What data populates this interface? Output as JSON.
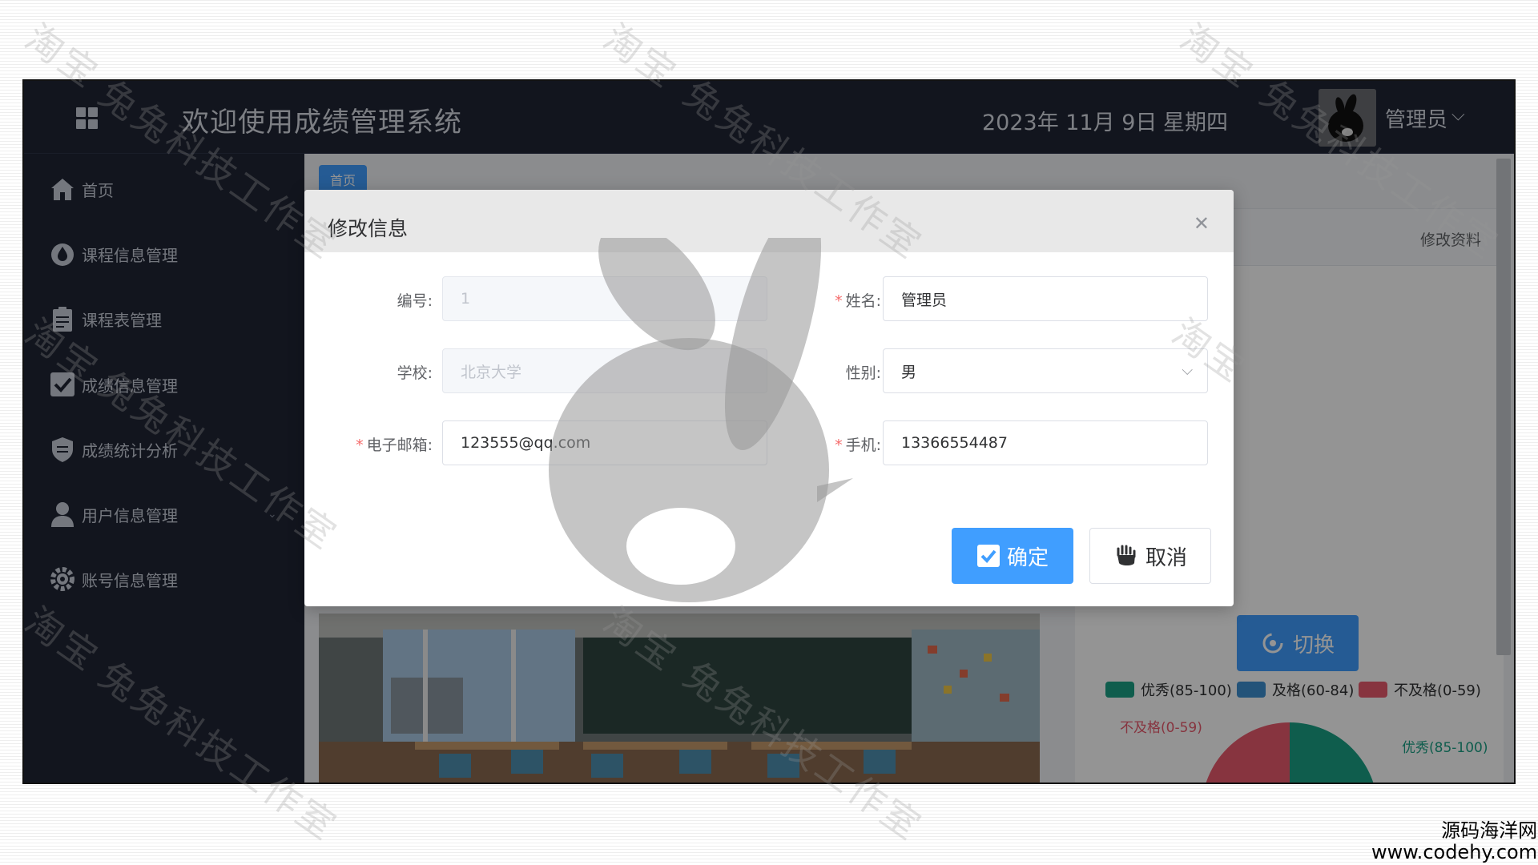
{
  "header": {
    "title": "欢迎使用成绩管理系统",
    "date": "2023年 11月 9日",
    "weekday": "星期四",
    "user_name": "管理员"
  },
  "sidebar": {
    "items": [
      {
        "label": "首页",
        "icon": "home-icon"
      },
      {
        "label": "课程信息管理",
        "icon": "drop-icon"
      },
      {
        "label": "课程表管理",
        "icon": "clipboard-icon"
      },
      {
        "label": "成绩信息管理",
        "icon": "checkbox-icon"
      },
      {
        "label": "成绩统计分析",
        "icon": "shield-icon"
      },
      {
        "label": "用户信息管理",
        "icon": "user-icon",
        "expandable": true
      },
      {
        "label": "账号信息管理",
        "icon": "gear-icon"
      }
    ]
  },
  "main": {
    "tab_home": "首页",
    "edit_profile": "修改资料",
    "switch_label": "切换",
    "legend": [
      {
        "label": "优秀(85-100)",
        "color": "#1aa085"
      },
      {
        "label": "及格(60-84)",
        "color": "#3d8fd0"
      },
      {
        "label": "不及格(0-59)",
        "color": "#e85a6d"
      }
    ],
    "pie_labels": {
      "left": "不及格(0-59)",
      "right": "优秀(85-100)"
    }
  },
  "dialog": {
    "title": "修改信息",
    "fields": {
      "id": {
        "label": "编号:",
        "value": "1",
        "required": false,
        "disabled": true
      },
      "name": {
        "label": "姓名:",
        "value": "管理员",
        "required": true
      },
      "school": {
        "label": "学校:",
        "value": "北京大学",
        "required": false,
        "disabled": true
      },
      "gender": {
        "label": "性别:",
        "value": "男",
        "required": false
      },
      "email": {
        "label": "电子邮箱:",
        "value": "123555@qq.com",
        "required": true
      },
      "phone": {
        "label": "手机:",
        "value": "13366554487",
        "required": true
      }
    },
    "confirm_label": "确定",
    "cancel_label": "取消"
  },
  "watermarks": {
    "text1": "淘宝",
    "text2": "兔兔科技工作室"
  },
  "site_badge": {
    "line1": "源码海洋网",
    "line2": "www.codehy.com"
  },
  "colors": {
    "primary": "#409eff",
    "header_bg": "#1f2535",
    "required": "#f56c6c"
  }
}
